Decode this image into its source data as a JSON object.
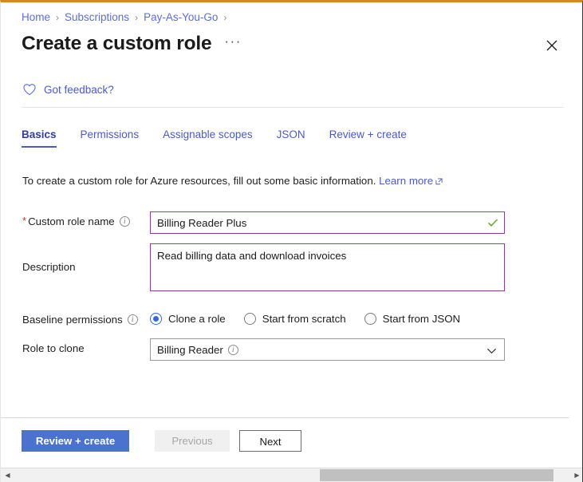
{
  "theme": {
    "accent_orange": "#d18b1f",
    "link_blue": "#4a5bc4",
    "primary_button_blue": "#4b72cf",
    "input_focus_purple": "#8a3fa0",
    "valid_green": "#6cab3e",
    "radio_blue": "#3767d6"
  },
  "breadcrumb": {
    "items": [
      {
        "label": "Home"
      },
      {
        "label": "Subscriptions"
      },
      {
        "label": "Pay-As-You-Go"
      }
    ],
    "separator": "›"
  },
  "header": {
    "title": "Create a custom role",
    "more_menu": "···",
    "close_icon": "close-icon"
  },
  "feedback": {
    "icon": "heart-icon",
    "label": "Got feedback?"
  },
  "tabs": [
    {
      "label": "Basics",
      "active": true
    },
    {
      "label": "Permissions",
      "active": false
    },
    {
      "label": "Assignable scopes",
      "active": false
    },
    {
      "label": "JSON",
      "active": false
    },
    {
      "label": "Review + create",
      "active": false
    }
  ],
  "intro": {
    "text": "To create a custom role for Azure resources, fill out some basic information.",
    "link_label": "Learn more",
    "link_icon": "external-link-icon"
  },
  "form": {
    "role_name": {
      "label": "Custom role name",
      "required_marker": "*",
      "value": "Billing Reader Plus",
      "placeholder": "",
      "validation": "valid",
      "info_icon": "info-icon"
    },
    "description": {
      "label": "Description",
      "value": "Read billing data and download invoices",
      "placeholder": ""
    },
    "baseline_permissions": {
      "label": "Baseline permissions",
      "info_icon": "info-icon",
      "options": [
        {
          "label": "Clone a role",
          "selected": true
        },
        {
          "label": "Start from scratch",
          "selected": false
        },
        {
          "label": "Start from JSON",
          "selected": false
        }
      ]
    },
    "role_to_clone": {
      "label": "Role to clone",
      "value": "Billing Reader",
      "info_icon": "info-icon",
      "chevron_icon": "chevron-down-icon"
    }
  },
  "footer": {
    "review_create_label": "Review + create",
    "previous_label": "Previous",
    "next_label": "Next"
  },
  "scrollbar": {
    "left_arrow": "◀",
    "right_arrow": "▶"
  }
}
